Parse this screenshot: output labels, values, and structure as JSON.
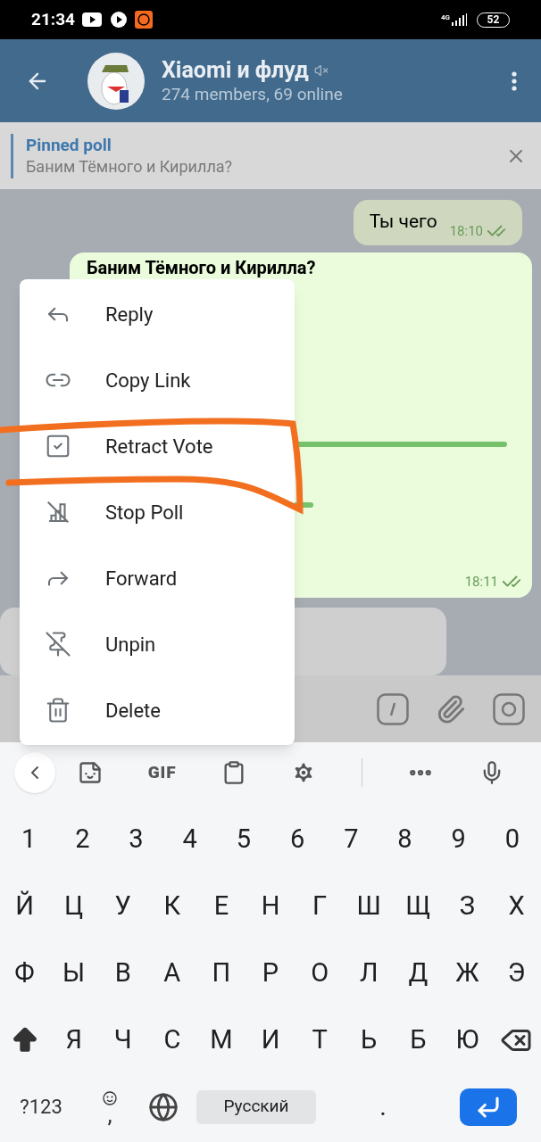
{
  "status_bar": {
    "time": "21:34",
    "network": "4G",
    "battery": "52"
  },
  "header": {
    "title": "Xiaomi и флуд",
    "muted": true,
    "subtitle": "274 members, 69 online"
  },
  "pinned": {
    "label": "Pinned poll",
    "text": "Баним Тёмного и Кирилла?"
  },
  "messages": [
    {
      "kind": "text",
      "text": "Ты чего",
      "time": "18:10",
      "read": true
    },
    {
      "kind": "poll",
      "question": "Баним Тёмного и Кирилла?",
      "time": "18:11",
      "read": true
    },
    {
      "kind": "incoming"
    }
  ],
  "context_menu": [
    {
      "kind": "reply",
      "label": "Reply"
    },
    {
      "kind": "link",
      "label": "Copy Link"
    },
    {
      "kind": "retract",
      "label": "Retract Vote"
    },
    {
      "kind": "stop",
      "label": "Stop Poll"
    },
    {
      "kind": "forward",
      "label": "Forward"
    },
    {
      "kind": "unpin",
      "label": "Unpin"
    },
    {
      "kind": "delete",
      "label": "Delete"
    }
  ],
  "keyboard": {
    "toolbar_gif": "GIF",
    "number_row": [
      {
        "kind": "char",
        "label": "1"
      },
      {
        "kind": "char",
        "label": "2"
      },
      {
        "kind": "char",
        "label": "3"
      },
      {
        "kind": "char",
        "label": "4"
      },
      {
        "kind": "char",
        "label": "5"
      },
      {
        "kind": "char",
        "label": "6"
      },
      {
        "kind": "char",
        "label": "7"
      },
      {
        "kind": "char",
        "label": "8"
      },
      {
        "kind": "char",
        "label": "9"
      },
      {
        "kind": "char",
        "label": "0"
      }
    ],
    "letter_rows": [
      [
        {
          "kind": "char",
          "label": "Й"
        },
        {
          "kind": "char",
          "label": "Ц"
        },
        {
          "kind": "char",
          "label": "У"
        },
        {
          "kind": "char",
          "label": "К"
        },
        {
          "kind": "char",
          "label": "Е"
        },
        {
          "kind": "char",
          "label": "Н"
        },
        {
          "kind": "char",
          "label": "Г"
        },
        {
          "kind": "char",
          "label": "Ш"
        },
        {
          "kind": "char",
          "label": "Щ"
        },
        {
          "kind": "char",
          "label": "З"
        },
        {
          "kind": "char",
          "label": "Х"
        }
      ],
      [
        {
          "kind": "char",
          "label": "Ф"
        },
        {
          "kind": "char",
          "label": "Ы"
        },
        {
          "kind": "char",
          "label": "В"
        },
        {
          "kind": "char",
          "label": "А"
        },
        {
          "kind": "char",
          "label": "П"
        },
        {
          "kind": "char",
          "label": "Р"
        },
        {
          "kind": "char",
          "label": "О"
        },
        {
          "kind": "char",
          "label": "Л"
        },
        {
          "kind": "char",
          "label": "Д"
        },
        {
          "kind": "char",
          "label": "Ж"
        },
        {
          "kind": "char",
          "label": "Э"
        }
      ],
      [
        {
          "kind": "shift"
        },
        {
          "kind": "char",
          "label": "Я"
        },
        {
          "kind": "char",
          "label": "Ч"
        },
        {
          "kind": "char",
          "label": "С"
        },
        {
          "kind": "char",
          "label": "М"
        },
        {
          "kind": "char",
          "label": "И"
        },
        {
          "kind": "char",
          "label": "Т"
        },
        {
          "kind": "char",
          "label": "Ь"
        },
        {
          "kind": "char",
          "label": "Б"
        },
        {
          "kind": "char",
          "label": "Ю"
        },
        {
          "kind": "backspace"
        }
      ],
      [
        {
          "kind": "mode",
          "label": "?123"
        },
        {
          "kind": "emoji",
          "label": ","
        },
        {
          "kind": "globe"
        },
        {
          "kind": "space",
          "label": "Русский"
        },
        {
          "kind": "char",
          "label": "."
        },
        {
          "kind": "enter"
        }
      ]
    ]
  }
}
